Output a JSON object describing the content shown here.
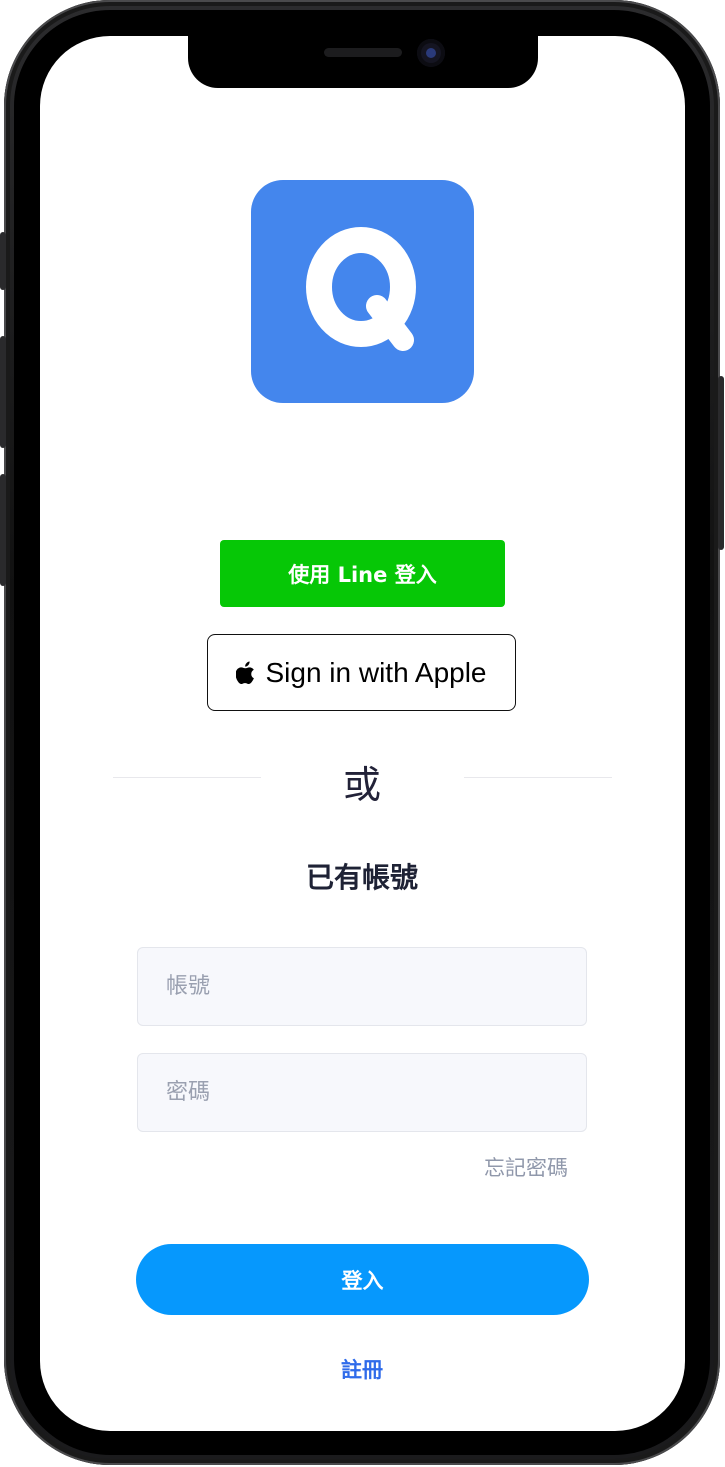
{
  "app": {
    "logo_letter": "Q",
    "brand_color": "#4486ed"
  },
  "social": {
    "line_label": "使用 Line 登入",
    "line_color": "#06c706",
    "apple_label": "Sign in with Apple",
    "apple_icon": "apple-logo-icon"
  },
  "divider": {
    "or_label": "或"
  },
  "login_form": {
    "heading": "已有帳號",
    "account_placeholder": "帳號",
    "account_value": "",
    "password_placeholder": "密碼",
    "password_value": "",
    "forgot_label": "忘記密碼",
    "submit_label": "登入",
    "submit_color": "#0698fd"
  },
  "footer": {
    "register_label": "註冊",
    "register_color": "#2f6bea"
  }
}
